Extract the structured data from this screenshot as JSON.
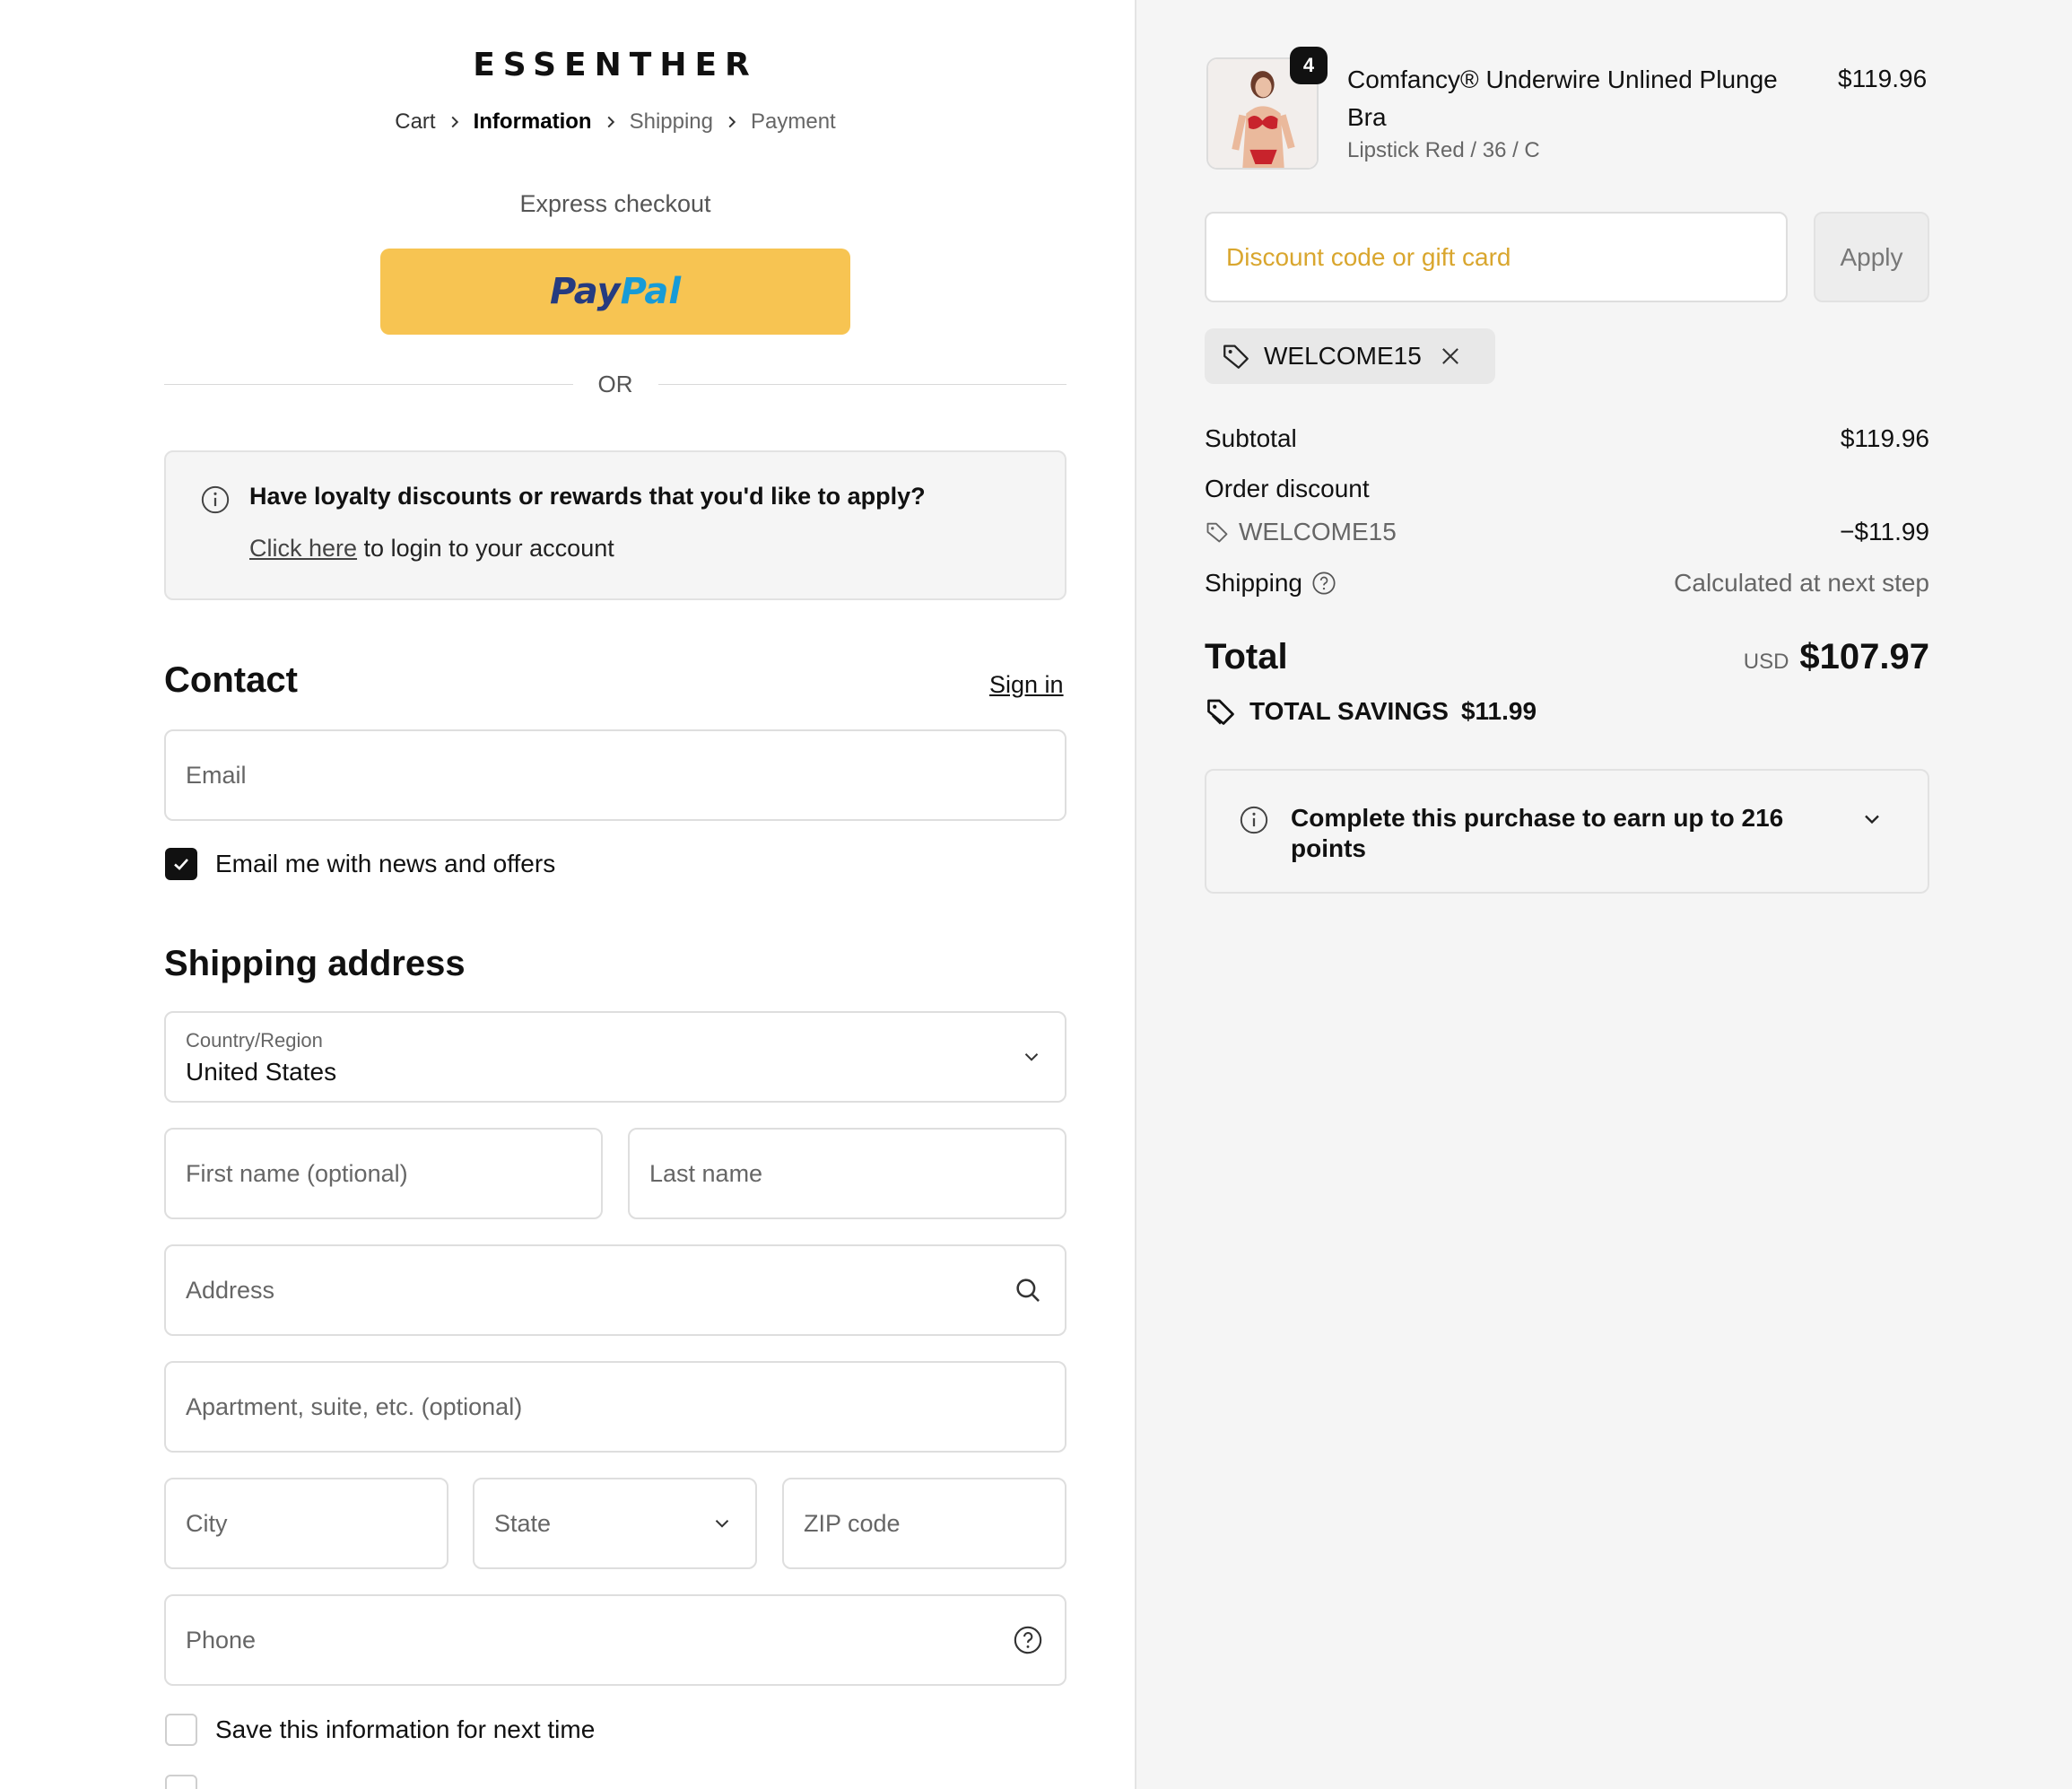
{
  "brand": {
    "name": "ESSENTHER"
  },
  "breadcrumb": {
    "items": [
      "Cart",
      "Information",
      "Shipping",
      "Payment"
    ]
  },
  "express": {
    "title": "Express checkout",
    "paypal_part1": "Pay",
    "paypal_part2": "Pal",
    "or_label": "OR"
  },
  "loyalty": {
    "title": "Have loyalty discounts or rewards that you'd like to apply?",
    "link_text": "Click here",
    "link_suffix": " to login to your account"
  },
  "contact": {
    "heading": "Contact",
    "signin_label": "Sign in",
    "email_placeholder": "Email",
    "newsletter_label": "Email me with news and offers",
    "newsletter_checked": true
  },
  "shipping": {
    "heading": "Shipping address",
    "country_label": "Country/Region",
    "country_value": "United States",
    "first_name_placeholder": "First name (optional)",
    "last_name_placeholder": "Last name",
    "address_placeholder": "Address",
    "apartment_placeholder": "Apartment, suite, etc. (optional)",
    "city_placeholder": "City",
    "state_placeholder": "State",
    "zip_placeholder": "ZIP code",
    "phone_placeholder": "Phone",
    "save_info_label": "Save this information for next time"
  },
  "order": {
    "item": {
      "quantity": "4",
      "name": "Comfancy® Underwire Unlined Plunge Bra",
      "variant": "Lipstick Red / 36 / C",
      "price": "$119.96"
    },
    "discount_placeholder": "Discount code or gift card",
    "apply_label": "Apply",
    "applied_code": "WELCOME15",
    "subtotal_label": "Subtotal",
    "subtotal_value": "$119.96",
    "order_discount_label": "Order discount",
    "discount_code": "WELCOME15",
    "discount_value": "−$11.99",
    "shipping_label": "Shipping",
    "shipping_value": "Calculated at next step",
    "total_label": "Total",
    "currency": "USD",
    "total_value": "$107.97",
    "savings_label": "TOTAL SAVINGS",
    "savings_value": "$11.99",
    "points_text": "Complete this purchase to earn up to 216 points"
  },
  "colors": {
    "paypal_yellow": "#f7c452",
    "discount_placeholder": "#d9a62e",
    "sidebar_bg": "#f5f5f5"
  }
}
